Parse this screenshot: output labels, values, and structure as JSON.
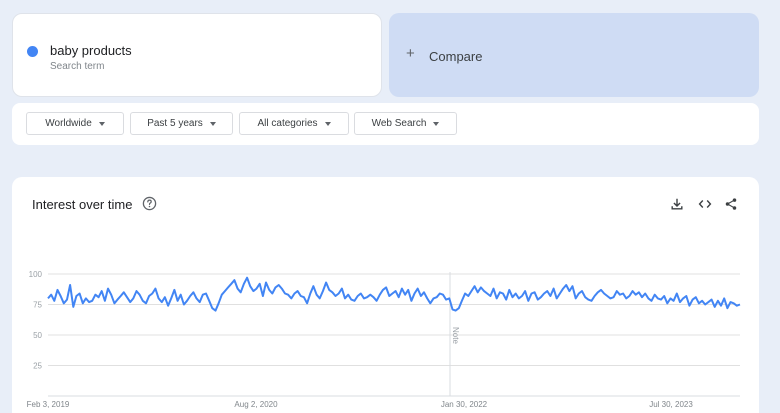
{
  "term": {
    "name": "baby products",
    "sub": "Search term",
    "color": "#4285f4"
  },
  "compare": {
    "label": "Compare"
  },
  "filters": {
    "region": "Worldwide",
    "period": "Past 5 years",
    "category": "All categories",
    "search_type": "Web Search"
  },
  "chart_section": {
    "title": "Interest over time",
    "icons": [
      "help-icon",
      "download-icon",
      "embed-icon",
      "share-icon"
    ]
  },
  "chart_data": {
    "type": "line",
    "title": "Interest over time",
    "ylim": [
      0,
      100
    ],
    "yticks": [
      "100",
      "75",
      "50",
      "25"
    ],
    "xticks": [
      "Feb 3, 2019",
      "Aug 2, 2020",
      "Jan 30, 2022",
      "Jul 30, 2023"
    ],
    "annotation": "Note",
    "grid": true,
    "series": [
      {
        "name": "baby products",
        "color": "#4285f4",
        "values": [
          80,
          83,
          78,
          87,
          82,
          76,
          79,
          91,
          73,
          82,
          84,
          76,
          80,
          77,
          78,
          83,
          81,
          86,
          78,
          88,
          83,
          76,
          79,
          82,
          85,
          81,
          77,
          80,
          86,
          83,
          78,
          76,
          82,
          84,
          88,
          80,
          77,
          81,
          74,
          80,
          87,
          78,
          83,
          75,
          78,
          82,
          85,
          80,
          77,
          83,
          84,
          78,
          72,
          70,
          76,
          83,
          86,
          89,
          92,
          95,
          88,
          85,
          92,
          97,
          90,
          86,
          88,
          92,
          82,
          93,
          87,
          84,
          89,
          91,
          88,
          84,
          83,
          80,
          84,
          86,
          82,
          81,
          76,
          84,
          90,
          83,
          80,
          86,
          93,
          87,
          85,
          82,
          84,
          88,
          80,
          83,
          79,
          78,
          82,
          84,
          80,
          81,
          83,
          81,
          78,
          83,
          87,
          89,
          82,
          84,
          86,
          81,
          88,
          83,
          87,
          78,
          84,
          88,
          82,
          85,
          80,
          76,
          80,
          81,
          84,
          83,
          79,
          80,
          71,
          70,
          72,
          78,
          84,
          82,
          86,
          90,
          85,
          89,
          86,
          84,
          82,
          88,
          80,
          85,
          84,
          79,
          87,
          81,
          84,
          80,
          82,
          86,
          78,
          84,
          85,
          79,
          81,
          84,
          86,
          82,
          88,
          80,
          84,
          88,
          91,
          86,
          90,
          80,
          84,
          86,
          81,
          79,
          78,
          82,
          85,
          87,
          84,
          82,
          80,
          81,
          86,
          83,
          84,
          80,
          82,
          86,
          83,
          85,
          81,
          84,
          80,
          78,
          83,
          80,
          79,
          82,
          76,
          80,
          78,
          84,
          77,
          80,
          82,
          74,
          79,
          81,
          76,
          78,
          75,
          77,
          79,
          73,
          78,
          74,
          80,
          72,
          77,
          76,
          74,
          75
        ]
      }
    ]
  }
}
